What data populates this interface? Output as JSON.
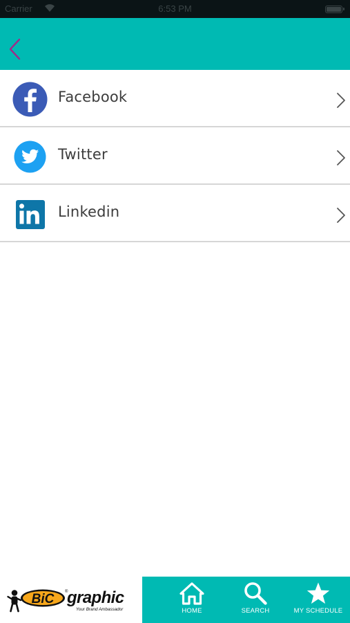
{
  "status_bar": {
    "carrier": "Carrier",
    "time": "6:53 PM",
    "wifi_icon": "wifi-icon",
    "battery_icon": "battery-icon"
  },
  "nav": {
    "back_icon": "chevron-left-icon",
    "back_color": "#9c2d8a",
    "background": "#00bab3"
  },
  "social_links": [
    {
      "label": "Facebook",
      "icon": "facebook-icon",
      "color": "#3b5bb6"
    },
    {
      "label": "Twitter",
      "icon": "twitter-icon",
      "color": "#1da1f2"
    },
    {
      "label": "Linkedin",
      "icon": "linkedin-icon",
      "color": "#0e76a8"
    }
  ],
  "brand": {
    "logo_text": "BiC graphic",
    "tagline": "Your Brand Ambassador"
  },
  "tab_bar": {
    "background": "#00bab3",
    "tabs": [
      {
        "label": "HOME",
        "icon": "home-icon"
      },
      {
        "label": "SEARCH",
        "icon": "search-icon"
      },
      {
        "label": "MY SCHEDULE",
        "icon": "star-icon"
      }
    ]
  }
}
